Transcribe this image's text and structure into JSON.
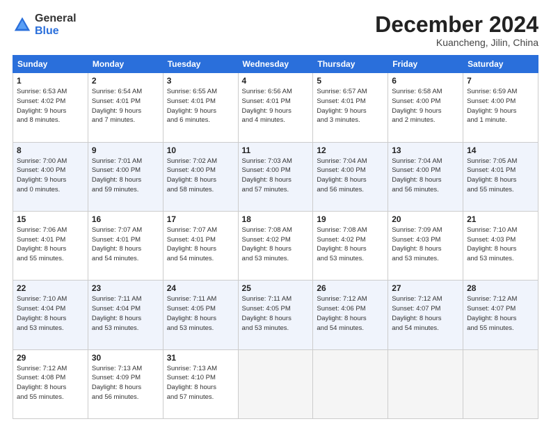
{
  "header": {
    "logo_line1": "General",
    "logo_line2": "Blue",
    "month_title": "December 2024",
    "location": "Kuancheng, Jilin, China"
  },
  "weekdays": [
    "Sunday",
    "Monday",
    "Tuesday",
    "Wednesday",
    "Thursday",
    "Friday",
    "Saturday"
  ],
  "weeks": [
    [
      {
        "day": "1",
        "info": "Sunrise: 6:53 AM\nSunset: 4:02 PM\nDaylight: 9 hours\nand 8 minutes."
      },
      {
        "day": "2",
        "info": "Sunrise: 6:54 AM\nSunset: 4:01 PM\nDaylight: 9 hours\nand 7 minutes."
      },
      {
        "day": "3",
        "info": "Sunrise: 6:55 AM\nSunset: 4:01 PM\nDaylight: 9 hours\nand 6 minutes."
      },
      {
        "day": "4",
        "info": "Sunrise: 6:56 AM\nSunset: 4:01 PM\nDaylight: 9 hours\nand 4 minutes."
      },
      {
        "day": "5",
        "info": "Sunrise: 6:57 AM\nSunset: 4:01 PM\nDaylight: 9 hours\nand 3 minutes."
      },
      {
        "day": "6",
        "info": "Sunrise: 6:58 AM\nSunset: 4:00 PM\nDaylight: 9 hours\nand 2 minutes."
      },
      {
        "day": "7",
        "info": "Sunrise: 6:59 AM\nSunset: 4:00 PM\nDaylight: 9 hours\nand 1 minute."
      }
    ],
    [
      {
        "day": "8",
        "info": "Sunrise: 7:00 AM\nSunset: 4:00 PM\nDaylight: 9 hours\nand 0 minutes."
      },
      {
        "day": "9",
        "info": "Sunrise: 7:01 AM\nSunset: 4:00 PM\nDaylight: 8 hours\nand 59 minutes."
      },
      {
        "day": "10",
        "info": "Sunrise: 7:02 AM\nSunset: 4:00 PM\nDaylight: 8 hours\nand 58 minutes."
      },
      {
        "day": "11",
        "info": "Sunrise: 7:03 AM\nSunset: 4:00 PM\nDaylight: 8 hours\nand 57 minutes."
      },
      {
        "day": "12",
        "info": "Sunrise: 7:04 AM\nSunset: 4:00 PM\nDaylight: 8 hours\nand 56 minutes."
      },
      {
        "day": "13",
        "info": "Sunrise: 7:04 AM\nSunset: 4:00 PM\nDaylight: 8 hours\nand 56 minutes."
      },
      {
        "day": "14",
        "info": "Sunrise: 7:05 AM\nSunset: 4:01 PM\nDaylight: 8 hours\nand 55 minutes."
      }
    ],
    [
      {
        "day": "15",
        "info": "Sunrise: 7:06 AM\nSunset: 4:01 PM\nDaylight: 8 hours\nand 55 minutes."
      },
      {
        "day": "16",
        "info": "Sunrise: 7:07 AM\nSunset: 4:01 PM\nDaylight: 8 hours\nand 54 minutes."
      },
      {
        "day": "17",
        "info": "Sunrise: 7:07 AM\nSunset: 4:01 PM\nDaylight: 8 hours\nand 54 minutes."
      },
      {
        "day": "18",
        "info": "Sunrise: 7:08 AM\nSunset: 4:02 PM\nDaylight: 8 hours\nand 53 minutes."
      },
      {
        "day": "19",
        "info": "Sunrise: 7:08 AM\nSunset: 4:02 PM\nDaylight: 8 hours\nand 53 minutes."
      },
      {
        "day": "20",
        "info": "Sunrise: 7:09 AM\nSunset: 4:03 PM\nDaylight: 8 hours\nand 53 minutes."
      },
      {
        "day": "21",
        "info": "Sunrise: 7:10 AM\nSunset: 4:03 PM\nDaylight: 8 hours\nand 53 minutes."
      }
    ],
    [
      {
        "day": "22",
        "info": "Sunrise: 7:10 AM\nSunset: 4:04 PM\nDaylight: 8 hours\nand 53 minutes."
      },
      {
        "day": "23",
        "info": "Sunrise: 7:11 AM\nSunset: 4:04 PM\nDaylight: 8 hours\nand 53 minutes."
      },
      {
        "day": "24",
        "info": "Sunrise: 7:11 AM\nSunset: 4:05 PM\nDaylight: 8 hours\nand 53 minutes."
      },
      {
        "day": "25",
        "info": "Sunrise: 7:11 AM\nSunset: 4:05 PM\nDaylight: 8 hours\nand 53 minutes."
      },
      {
        "day": "26",
        "info": "Sunrise: 7:12 AM\nSunset: 4:06 PM\nDaylight: 8 hours\nand 54 minutes."
      },
      {
        "day": "27",
        "info": "Sunrise: 7:12 AM\nSunset: 4:07 PM\nDaylight: 8 hours\nand 54 minutes."
      },
      {
        "day": "28",
        "info": "Sunrise: 7:12 AM\nSunset: 4:07 PM\nDaylight: 8 hours\nand 55 minutes."
      }
    ],
    [
      {
        "day": "29",
        "info": "Sunrise: 7:12 AM\nSunset: 4:08 PM\nDaylight: 8 hours\nand 55 minutes."
      },
      {
        "day": "30",
        "info": "Sunrise: 7:13 AM\nSunset: 4:09 PM\nDaylight: 8 hours\nand 56 minutes."
      },
      {
        "day": "31",
        "info": "Sunrise: 7:13 AM\nSunset: 4:10 PM\nDaylight: 8 hours\nand 57 minutes."
      },
      {
        "day": "",
        "info": ""
      },
      {
        "day": "",
        "info": ""
      },
      {
        "day": "",
        "info": ""
      },
      {
        "day": "",
        "info": ""
      }
    ]
  ]
}
